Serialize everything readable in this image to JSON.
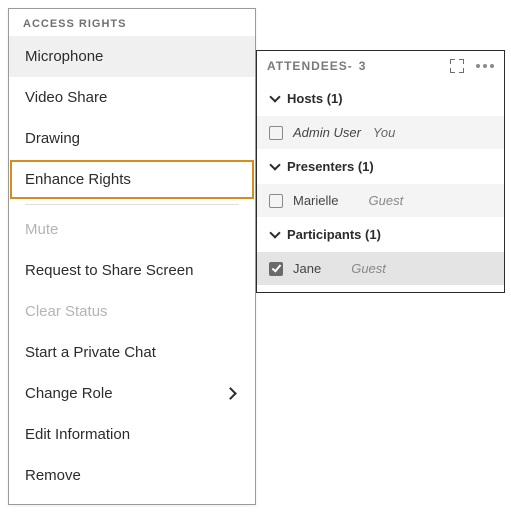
{
  "menu": {
    "header": "ACCESS RIGHTS",
    "items": {
      "microphone": "Microphone",
      "video_share": "Video Share",
      "drawing": "Drawing",
      "enhance_rights": "Enhance Rights",
      "mute": "Mute",
      "request_share": "Request to Share Screen",
      "clear_status": "Clear Status",
      "private_chat": "Start a Private Chat",
      "change_role": "Change Role",
      "edit_info": "Edit Information",
      "remove": "Remove"
    }
  },
  "attendees": {
    "title": "ATTENDEES",
    "count_sep": " - ",
    "count": "3",
    "groups": {
      "hosts": {
        "label": "Hosts (1)",
        "rows": [
          {
            "name": "Admin User",
            "suffix": "You",
            "checked": false
          }
        ]
      },
      "presenters": {
        "label": "Presenters (1)",
        "rows": [
          {
            "name": "Marielle",
            "suffix": "Guest",
            "checked": false
          }
        ]
      },
      "participants": {
        "label": "Participants (1)",
        "rows": [
          {
            "name": "Jane",
            "suffix": "Guest",
            "checked": true
          }
        ]
      }
    }
  }
}
